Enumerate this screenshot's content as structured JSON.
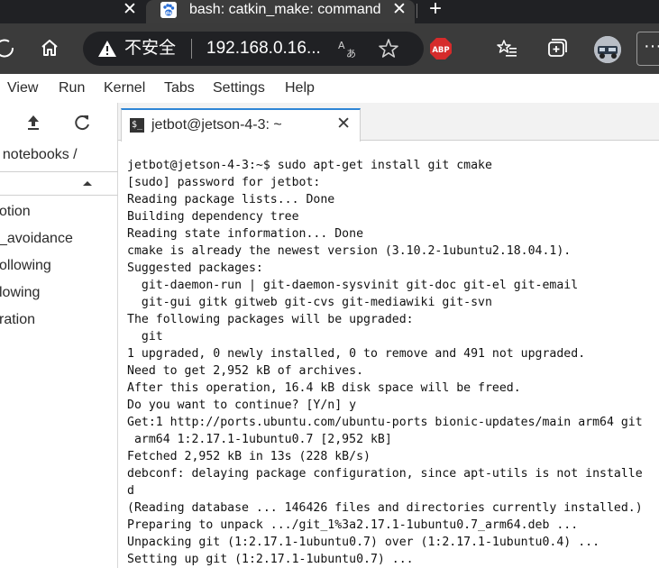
{
  "browser": {
    "prev_tab_close_glyph": "✕",
    "active_tab": {
      "title": "bash: catkin_make: command no",
      "favicon_icon": "baidu-paw-icon",
      "close_glyph": "✕"
    },
    "new_tab_glyph": "+",
    "address_bar": {
      "security_label": "不安全",
      "url": "192.168.0.16...",
      "translate_icon": "translate-icon",
      "favorite_icon": "star-icon"
    },
    "extensions": {
      "abp_label": "ABP"
    },
    "more_glyph": "···"
  },
  "jupyter": {
    "menu": [
      "View",
      "Run",
      "Kernel",
      "Tabs",
      "Settings",
      "Help"
    ],
    "filebrowser": {
      "breadcrumb": "/ notebooks /",
      "items": [
        "otion",
        "_avoidance",
        "ollowing",
        "lowing",
        "ration"
      ]
    },
    "terminal_tab": {
      "label": "jetbot@jetson-4-3: ~",
      "close_glyph": "✕"
    },
    "terminal": {
      "lines": [
        "jetbot@jetson-4-3:~$ sudo apt-get install git cmake",
        "[sudo] password for jetbot:",
        "Reading package lists... Done",
        "Building dependency tree",
        "Reading state information... Done",
        "cmake is already the newest version (3.10.2-1ubuntu2.18.04.1).",
        "Suggested packages:",
        "  git-daemon-run | git-daemon-sysvinit git-doc git-el git-email",
        "  git-gui gitk gitweb git-cvs git-mediawiki git-svn",
        "The following packages will be upgraded:",
        "  git",
        "1 upgraded, 0 newly installed, 0 to remove and 491 not upgraded.",
        "Need to get 2,952 kB of archives.",
        "After this operation, 16.4 kB disk space will be freed.",
        "Do you want to continue? [Y/n] y",
        "Get:1 http://ports.ubuntu.com/ubuntu-ports bionic-updates/main arm64 git",
        " arm64 1:2.17.1-1ubuntu0.7 [2,952 kB]",
        "Fetched 2,952 kB in 13s (228 kB/s)",
        "debconf: delaying package configuration, since apt-utils is not installe",
        "d",
        "(Reading database ... 146426 files and directories currently installed.)",
        "Preparing to unpack .../git_1%3a2.17.1-1ubuntu0.7_arm64.deb ...",
        "Unpacking git (1:2.17.1-1ubuntu0.7) over (1:2.17.1-1ubuntu0.4) ...",
        "Setting up git (1:2.17.1-1ubuntu0.7) ..."
      ]
    }
  }
}
